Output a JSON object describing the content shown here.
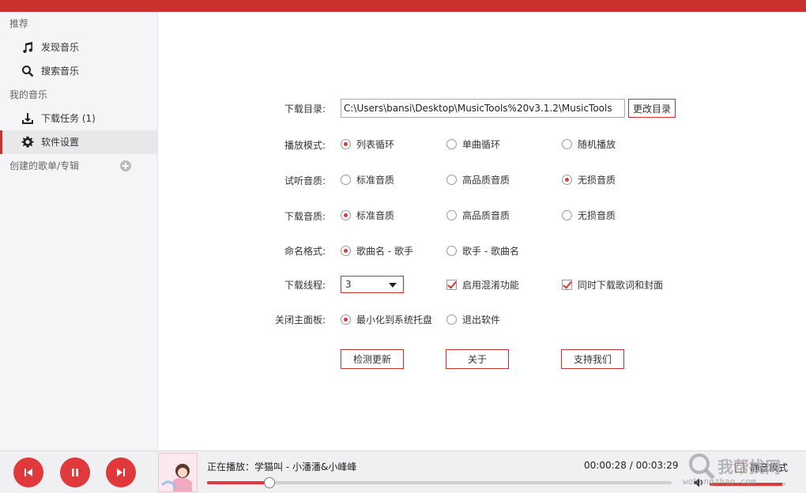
{
  "sidebar": {
    "section_recommend": "推荐",
    "items_recommend": [
      {
        "label": "发现音乐",
        "icon": "music-note-icon"
      },
      {
        "label": "搜索音乐",
        "icon": "search-icon"
      }
    ],
    "section_my_music": "我的音乐",
    "items_my_music": [
      {
        "label": "下载任务 (1)",
        "icon": "download-icon"
      },
      {
        "label": "软件设置",
        "icon": "gear-icon",
        "active": true
      }
    ],
    "section_playlists": "创建的歌单/专辑",
    "add_playlist_icon": "plus-circle-icon"
  },
  "settings": {
    "download_dir": {
      "label": "下载目录:",
      "value": "C:\\Users\\bansi\\Desktop\\MusicTools%20v3.1.2\\MusicTools",
      "change_button": "更改目录"
    },
    "play_mode": {
      "label": "播放模式:",
      "options": [
        "列表循环",
        "单曲循环",
        "随机播放"
      ],
      "selected": "列表循环"
    },
    "preview_quality": {
      "label": "试听音质:",
      "options": [
        "标准音质",
        "高品质音质",
        "无损音质"
      ],
      "selected": "无损音质"
    },
    "download_quality": {
      "label": "下载音质:",
      "options": [
        "标准音质",
        "高品质音质",
        "无损音质"
      ],
      "selected": "标准音质"
    },
    "naming_format": {
      "label": "命名格式:",
      "options": [
        "歌曲名 - 歌手",
        "歌手 - 歌曲名"
      ],
      "selected": "歌曲名 - 歌手"
    },
    "download_threads": {
      "label": "下载线程:",
      "value": "3",
      "checkbox_obfuscation": {
        "label": "启用混淆功能",
        "checked": true
      },
      "checkbox_lyrics_cover": {
        "label": "同时下载歌词和封面",
        "checked": true
      }
    },
    "close_panel": {
      "label": "关闭主面板:",
      "options": [
        "最小化到系统托盘",
        "退出软件"
      ],
      "selected": "最小化到系统托盘"
    },
    "buttons": {
      "check_update": "检测更新",
      "about": "关于",
      "support": "支持我们"
    }
  },
  "player": {
    "now_playing": "正在播放：学猫叫 - 小潘潘&小峰峰",
    "time": "00:00:28 / 00:03:29",
    "progress": 0.134,
    "volume": 0.96,
    "mute_label": "静音模式",
    "mute_checked": false,
    "colors": {
      "accent": "#e0393b",
      "topbar": "#c9312f"
    }
  },
  "watermark": {
    "text": "我帮找网",
    "url": "wobangzhao.com"
  }
}
